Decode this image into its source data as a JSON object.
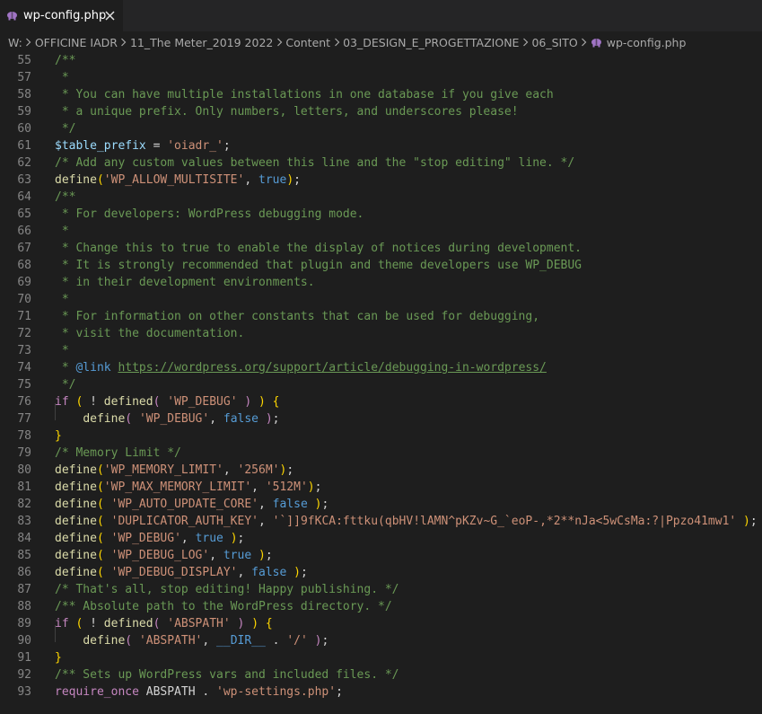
{
  "tab": {
    "label": "wp-config.php",
    "close_glyph": "✕",
    "icon": "php-elephant-icon",
    "icon_color": "#a074c4"
  },
  "breadcrumb": [
    "W:",
    "OFFICINE IADR",
    "11_The Meter_2019 2022",
    "Content",
    "03_DESIGN_E_PROGETTAZIONE",
    "06_SITO",
    "wp-config.php"
  ],
  "theme": {
    "comment": "#6a9955",
    "string": "#ce9178",
    "variable": "#9cdcfe",
    "function": "#dcdcaa",
    "keyword": "#c586c0",
    "constant": "#569cd6",
    "bracket": "#ffd700"
  },
  "lines": [
    {
      "n": "55",
      "tokens": [
        [
          "c",
          "/**"
        ]
      ]
    },
    {
      "n": "57",
      "tokens": [
        [
          "c",
          " *"
        ]
      ]
    },
    {
      "n": "58",
      "tokens": [
        [
          "c",
          " * You can have multiple installations in one database if you give each"
        ]
      ]
    },
    {
      "n": "59",
      "tokens": [
        [
          "c",
          " * a unique prefix. Only numbers, letters, and underscores please!"
        ]
      ]
    },
    {
      "n": "60",
      "tokens": [
        [
          "c",
          " */"
        ]
      ]
    },
    {
      "n": "61",
      "tokens": [
        [
          "v",
          "$table_prefix"
        ],
        [
          "p",
          " = "
        ],
        [
          "s",
          "'oiadr_'"
        ],
        [
          "p",
          ";"
        ]
      ]
    },
    {
      "n": "62",
      "tokens": [
        [
          "c",
          "/* Add any custom values between this line and the \"stop editing\" line. */"
        ]
      ]
    },
    {
      "n": "63",
      "tokens": [
        [
          "f",
          "define"
        ],
        [
          "y",
          "("
        ],
        [
          "s",
          "'WP_ALLOW_MULTISITE'"
        ],
        [
          "p",
          ", "
        ],
        [
          "b",
          "true"
        ],
        [
          "y",
          ")"
        ],
        [
          "p",
          ";"
        ]
      ]
    },
    {
      "n": "64",
      "tokens": [
        [
          "c",
          "/**"
        ]
      ]
    },
    {
      "n": "65",
      "tokens": [
        [
          "c",
          " * For developers: WordPress debugging mode."
        ]
      ]
    },
    {
      "n": "66",
      "tokens": [
        [
          "c",
          " *"
        ]
      ]
    },
    {
      "n": "67",
      "tokens": [
        [
          "c",
          " * Change this to true to enable the display of notices during development."
        ]
      ]
    },
    {
      "n": "68",
      "tokens": [
        [
          "c",
          " * It is strongly recommended that plugin and theme developers use WP_DEBUG"
        ]
      ]
    },
    {
      "n": "69",
      "tokens": [
        [
          "c",
          " * in their development environments."
        ]
      ]
    },
    {
      "n": "70",
      "tokens": [
        [
          "c",
          " *"
        ]
      ]
    },
    {
      "n": "71",
      "tokens": [
        [
          "c",
          " * For information on other constants that can be used for debugging,"
        ]
      ]
    },
    {
      "n": "72",
      "tokens": [
        [
          "c",
          " * visit the documentation."
        ]
      ]
    },
    {
      "n": "73",
      "tokens": [
        [
          "c",
          " *"
        ]
      ]
    },
    {
      "n": "74",
      "tokens": [
        [
          "c",
          " * "
        ],
        [
          "ct",
          "@link"
        ],
        [
          "c",
          " "
        ],
        [
          "u",
          "https://wordpress.org/support/article/debugging-in-wordpress/"
        ]
      ]
    },
    {
      "n": "75",
      "tokens": [
        [
          "c",
          " */"
        ]
      ]
    },
    {
      "n": "76",
      "tokens": [
        [
          "k",
          "if"
        ],
        [
          "p",
          " "
        ],
        [
          "y",
          "("
        ],
        [
          "p",
          " ! "
        ],
        [
          "f",
          "defined"
        ],
        [
          "k",
          "("
        ],
        [
          "p",
          " "
        ],
        [
          "s",
          "'WP_DEBUG'"
        ],
        [
          "p",
          " "
        ],
        [
          "k",
          ")"
        ],
        [
          "p",
          " "
        ],
        [
          "y",
          ")"
        ],
        [
          "p",
          " "
        ],
        [
          "y",
          "{"
        ]
      ]
    },
    {
      "n": "77",
      "tokens": [
        [
          "p",
          "    "
        ],
        [
          "f",
          "define"
        ],
        [
          "k",
          "("
        ],
        [
          "p",
          " "
        ],
        [
          "s",
          "'WP_DEBUG'"
        ],
        [
          "p",
          ", "
        ],
        [
          "b",
          "false"
        ],
        [
          "p",
          " "
        ],
        [
          "k",
          ")"
        ],
        [
          "p",
          ";"
        ]
      ]
    },
    {
      "n": "78",
      "tokens": [
        [
          "y",
          "}"
        ]
      ]
    },
    {
      "n": "79",
      "tokens": [
        [
          "c",
          "/* Memory Limit */"
        ]
      ]
    },
    {
      "n": "80",
      "tokens": [
        [
          "f",
          "define"
        ],
        [
          "y",
          "("
        ],
        [
          "s",
          "'WP_MEMORY_LIMIT'"
        ],
        [
          "p",
          ", "
        ],
        [
          "s",
          "'256M'"
        ],
        [
          "y",
          ")"
        ],
        [
          "p",
          ";"
        ]
      ]
    },
    {
      "n": "81",
      "tokens": [
        [
          "f",
          "define"
        ],
        [
          "y",
          "("
        ],
        [
          "s",
          "'WP_MAX_MEMORY_LIMIT'"
        ],
        [
          "p",
          ", "
        ],
        [
          "s",
          "'512M'"
        ],
        [
          "y",
          ")"
        ],
        [
          "p",
          ";"
        ]
      ]
    },
    {
      "n": "82",
      "tokens": [
        [
          "f",
          "define"
        ],
        [
          "y",
          "("
        ],
        [
          "p",
          " "
        ],
        [
          "s",
          "'WP_AUTO_UPDATE_CORE'"
        ],
        [
          "p",
          ", "
        ],
        [
          "b",
          "false"
        ],
        [
          "p",
          " "
        ],
        [
          "y",
          ")"
        ],
        [
          "p",
          ";"
        ]
      ]
    },
    {
      "n": "83",
      "tokens": [
        [
          "f",
          "define"
        ],
        [
          "y",
          "("
        ],
        [
          "p",
          " "
        ],
        [
          "s",
          "'DUPLICATOR_AUTH_KEY'"
        ],
        [
          "p",
          ", "
        ],
        [
          "s",
          "'`]]9fKCA:fttku(qbHV!lAMN^pKZv~G_`eoP-,*2**nJa<5wCsMa:?|Ppzo41mw1'"
        ],
        [
          "p",
          " "
        ],
        [
          "y",
          ")"
        ],
        [
          "p",
          ";"
        ]
      ]
    },
    {
      "n": "84",
      "tokens": [
        [
          "f",
          "define"
        ],
        [
          "y",
          "("
        ],
        [
          "p",
          " "
        ],
        [
          "s",
          "'WP_DEBUG'"
        ],
        [
          "p",
          ", "
        ],
        [
          "b",
          "true"
        ],
        [
          "p",
          " "
        ],
        [
          "y",
          ")"
        ],
        [
          "p",
          ";"
        ]
      ]
    },
    {
      "n": "85",
      "tokens": [
        [
          "f",
          "define"
        ],
        [
          "y",
          "("
        ],
        [
          "p",
          " "
        ],
        [
          "s",
          "'WP_DEBUG_LOG'"
        ],
        [
          "p",
          ", "
        ],
        [
          "b",
          "true"
        ],
        [
          "p",
          " "
        ],
        [
          "y",
          ")"
        ],
        [
          "p",
          ";"
        ]
      ]
    },
    {
      "n": "86",
      "tokens": [
        [
          "f",
          "define"
        ],
        [
          "y",
          "("
        ],
        [
          "p",
          " "
        ],
        [
          "s",
          "'WP_DEBUG_DISPLAY'"
        ],
        [
          "p",
          ", "
        ],
        [
          "b",
          "false"
        ],
        [
          "p",
          " "
        ],
        [
          "y",
          ")"
        ],
        [
          "p",
          ";"
        ]
      ]
    },
    {
      "n": "87",
      "tokens": [
        [
          "c",
          "/* That's all, stop editing! Happy publishing. */"
        ]
      ]
    },
    {
      "n": "88",
      "tokens": [
        [
          "c",
          "/** Absolute path to the WordPress directory. */"
        ]
      ]
    },
    {
      "n": "89",
      "tokens": [
        [
          "k",
          "if"
        ],
        [
          "p",
          " "
        ],
        [
          "y",
          "("
        ],
        [
          "p",
          " ! "
        ],
        [
          "f",
          "defined"
        ],
        [
          "k",
          "("
        ],
        [
          "p",
          " "
        ],
        [
          "s",
          "'ABSPATH'"
        ],
        [
          "p",
          " "
        ],
        [
          "k",
          ")"
        ],
        [
          "p",
          " "
        ],
        [
          "y",
          ")"
        ],
        [
          "p",
          " "
        ],
        [
          "y",
          "{"
        ]
      ]
    },
    {
      "n": "90",
      "tokens": [
        [
          "p",
          "    "
        ],
        [
          "f",
          "define"
        ],
        [
          "k",
          "("
        ],
        [
          "p",
          " "
        ],
        [
          "s",
          "'ABSPATH'"
        ],
        [
          "p",
          ", "
        ],
        [
          "b",
          "__DIR__"
        ],
        [
          "p",
          " . "
        ],
        [
          "s",
          "'/'"
        ],
        [
          "p",
          " "
        ],
        [
          "k",
          ")"
        ],
        [
          "p",
          ";"
        ]
      ]
    },
    {
      "n": "91",
      "tokens": [
        [
          "y",
          "}"
        ]
      ]
    },
    {
      "n": "92",
      "tokens": [
        [
          "c",
          "/** Sets up WordPress vars and included files. */"
        ]
      ]
    },
    {
      "n": "93",
      "tokens": [
        [
          "k",
          "require_once"
        ],
        [
          "p",
          " ABSPATH . "
        ],
        [
          "s",
          "'wp-settings.php'"
        ],
        [
          "p",
          ";"
        ]
      ]
    }
  ]
}
